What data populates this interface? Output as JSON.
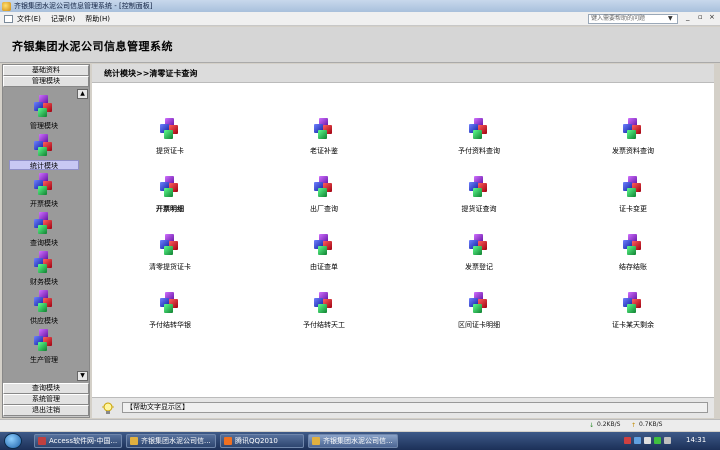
{
  "window": {
    "title": "齐银集团水泥公司信息管理系统 - [控制面板]"
  },
  "menu": {
    "items": [
      "文件(E)",
      "记录(R)",
      "帮助(H)"
    ],
    "help_search": "键入需要帮助的问题",
    "win_min": "_",
    "win_restore": "▫",
    "win_close": "×"
  },
  "header": {
    "title": "齐银集团水泥公司信息管理系统"
  },
  "nav": {
    "top_buttons": [
      "基础资料",
      "管理模块"
    ],
    "modules": [
      "管理模块",
      "统计模块",
      "开票模块",
      "查询模块",
      "财务模块",
      "供应模块",
      "生产管理"
    ],
    "active_module": "统计模块",
    "bottom_buttons": [
      "查询模块",
      "系统管理",
      "退出注销"
    ],
    "scroll_up": "▲",
    "scroll_down": "▼"
  },
  "main": {
    "section_title": "统计模块>>清零证卡查询",
    "items": [
      "提货证卡",
      "老证补鉴",
      "予付资料查询",
      "发票资料查询",
      "开票明细",
      "出厂查询",
      "提货证查询",
      "证卡变更",
      "清零提货证卡",
      "由证查单",
      "发票登记",
      "结存结账",
      "予付结转华银",
      "予付结转天工",
      "区间证卡明细",
      "证卡某天剩余"
    ],
    "help_text": "【帮助文字显示区】"
  },
  "status": {
    "down_speed": "0.2KB/S",
    "up_speed": "0.7KB/S"
  },
  "taskbar": {
    "tasks": [
      "Access软件网-中国...",
      "齐银集团水泥公司信...",
      "腾讯QQ2010",
      "齐银集团水泥公司信..."
    ],
    "clock": "14:31"
  }
}
